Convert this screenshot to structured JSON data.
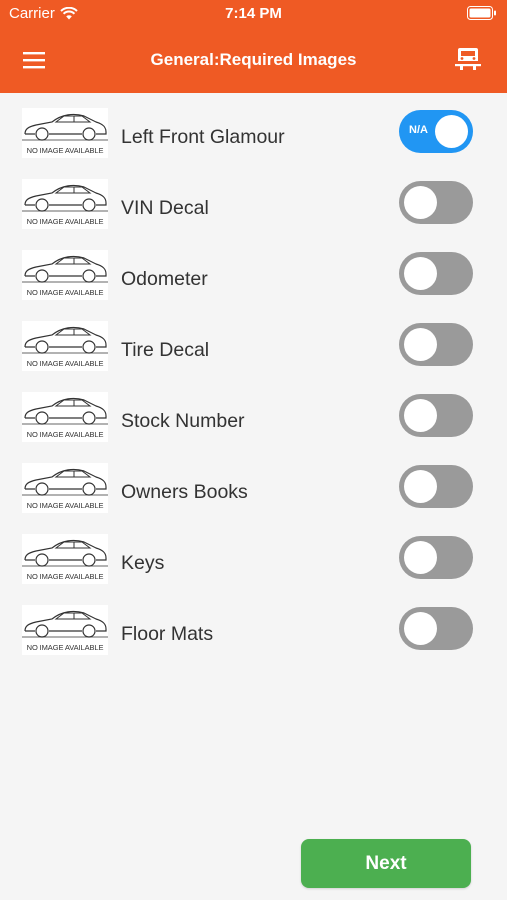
{
  "status": {
    "carrier": "Carrier",
    "time": "7:14 PM"
  },
  "header": {
    "title": "General:Required Images",
    "bg_color": "#ef5a24"
  },
  "thumb_caption": "NO IMAGE AVAILABLE",
  "items": [
    {
      "label": "Left Front Glamour",
      "toggle_on": true,
      "toggle_text": "N/A"
    },
    {
      "label": "VIN Decal",
      "toggle_on": false
    },
    {
      "label": "Odometer",
      "toggle_on": false
    },
    {
      "label": "Tire Decal",
      "toggle_on": false
    },
    {
      "label": "Stock Number",
      "toggle_on": false
    },
    {
      "label": "Owners Books",
      "toggle_on": false
    },
    {
      "label": "Keys",
      "toggle_on": false
    },
    {
      "label": "Floor Mats",
      "toggle_on": false
    }
  ],
  "next_label": "Next",
  "colors": {
    "toggle_on": "#2196f3",
    "toggle_off": "#9a9a9a",
    "next": "#4caf50"
  }
}
